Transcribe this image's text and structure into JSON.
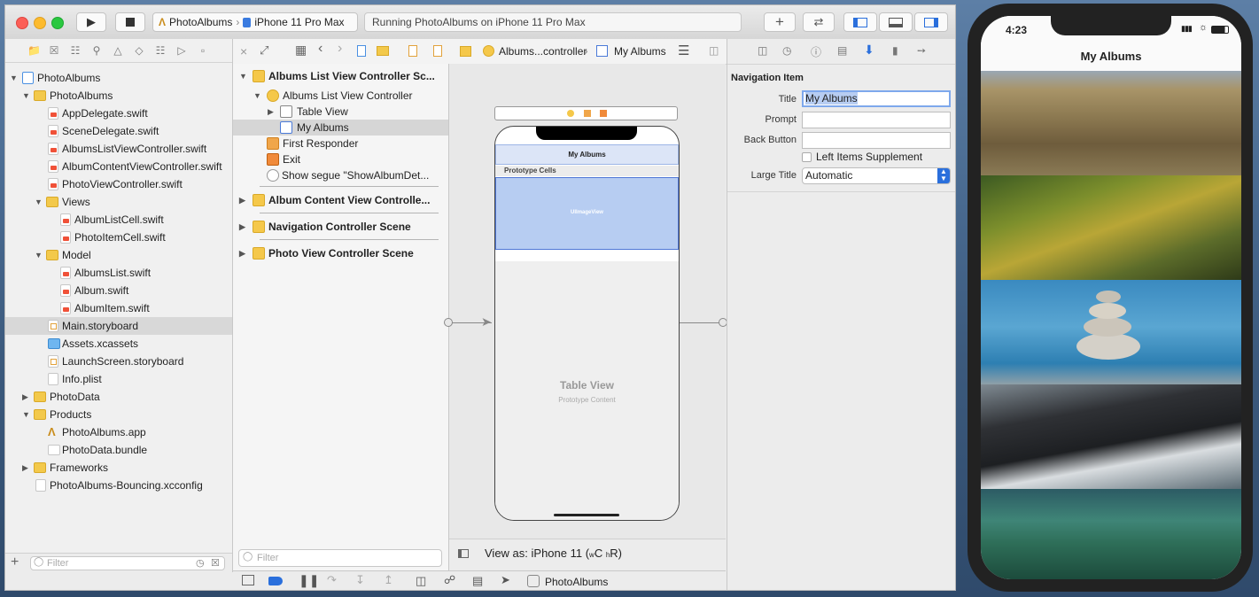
{
  "toolbar": {
    "scheme_app": "PhotoAlbums",
    "scheme_device": "iPhone 11 Pro Max",
    "activity_text": "Running PhotoAlbums on iPhone 11 Pro Max"
  },
  "navigator": {
    "items": [
      {
        "label": "PhotoAlbums"
      },
      {
        "label": "PhotoAlbums"
      },
      {
        "label": "AppDelegate.swift"
      },
      {
        "label": "SceneDelegate.swift"
      },
      {
        "label": "AlbumsListViewController.swift"
      },
      {
        "label": "AlbumContentViewController.swift"
      },
      {
        "label": "PhotoViewController.swift"
      },
      {
        "label": "Views"
      },
      {
        "label": "AlbumListCell.swift"
      },
      {
        "label": "PhotoItemCell.swift"
      },
      {
        "label": "Model"
      },
      {
        "label": "AlbumsList.swift"
      },
      {
        "label": "Album.swift"
      },
      {
        "label": "AlbumItem.swift"
      },
      {
        "label": "Main.storyboard"
      },
      {
        "label": "Assets.xcassets"
      },
      {
        "label": "LaunchScreen.storyboard"
      },
      {
        "label": "Info.plist"
      },
      {
        "label": "PhotoData"
      },
      {
        "label": "Products"
      },
      {
        "label": "PhotoAlbums.app"
      },
      {
        "label": "PhotoData.bundle"
      },
      {
        "label": "Frameworks"
      },
      {
        "label": "PhotoAlbums-Bouncing.xcconfig"
      }
    ],
    "filter_placeholder": "Filter"
  },
  "jumpbar": {
    "crumb_controller": "Albums...controller",
    "crumb_item": "My Albums"
  },
  "outline": {
    "rows": [
      {
        "label": "Albums List View Controller Sc..."
      },
      {
        "label": "Albums List View Controller"
      },
      {
        "label": "Table View"
      },
      {
        "label": "My Albums"
      },
      {
        "label": "First Responder"
      },
      {
        "label": "Exit"
      },
      {
        "label": "Show segue \"ShowAlbumDet..."
      },
      {
        "label": "Album Content View Controlle..."
      },
      {
        "label": "Navigation Controller Scene"
      },
      {
        "label": "Photo View Controller Scene"
      }
    ],
    "filter_placeholder": "Filter"
  },
  "canvas": {
    "nav_title": "My Albums",
    "prototype_cells": "Prototype Cells",
    "image_view": "UIImageView",
    "table_view": "Table View",
    "prototype_content": "Prototype Content",
    "view_as_prefix": "View as: iPhone 11 (",
    "view_as_w": "w",
    "view_as_c": "C",
    "view_as_h": "h",
    "view_as_r": "R)"
  },
  "inspector": {
    "section": "Navigation Item",
    "title_label": "Title",
    "title_value": "My Albums",
    "prompt_label": "Prompt",
    "back_label": "Back Button",
    "left_items_label": "Left Items Supplement",
    "large_title_label": "Large Title",
    "large_title_value": "Automatic"
  },
  "debugbar": {
    "scheme_label": "PhotoAlbums"
  },
  "simulator": {
    "time": "4:23",
    "nav_title": "My Albums"
  },
  "colors": {
    "accent": "#2a6fdc",
    "selection_highlight": "#b7cdf2"
  }
}
